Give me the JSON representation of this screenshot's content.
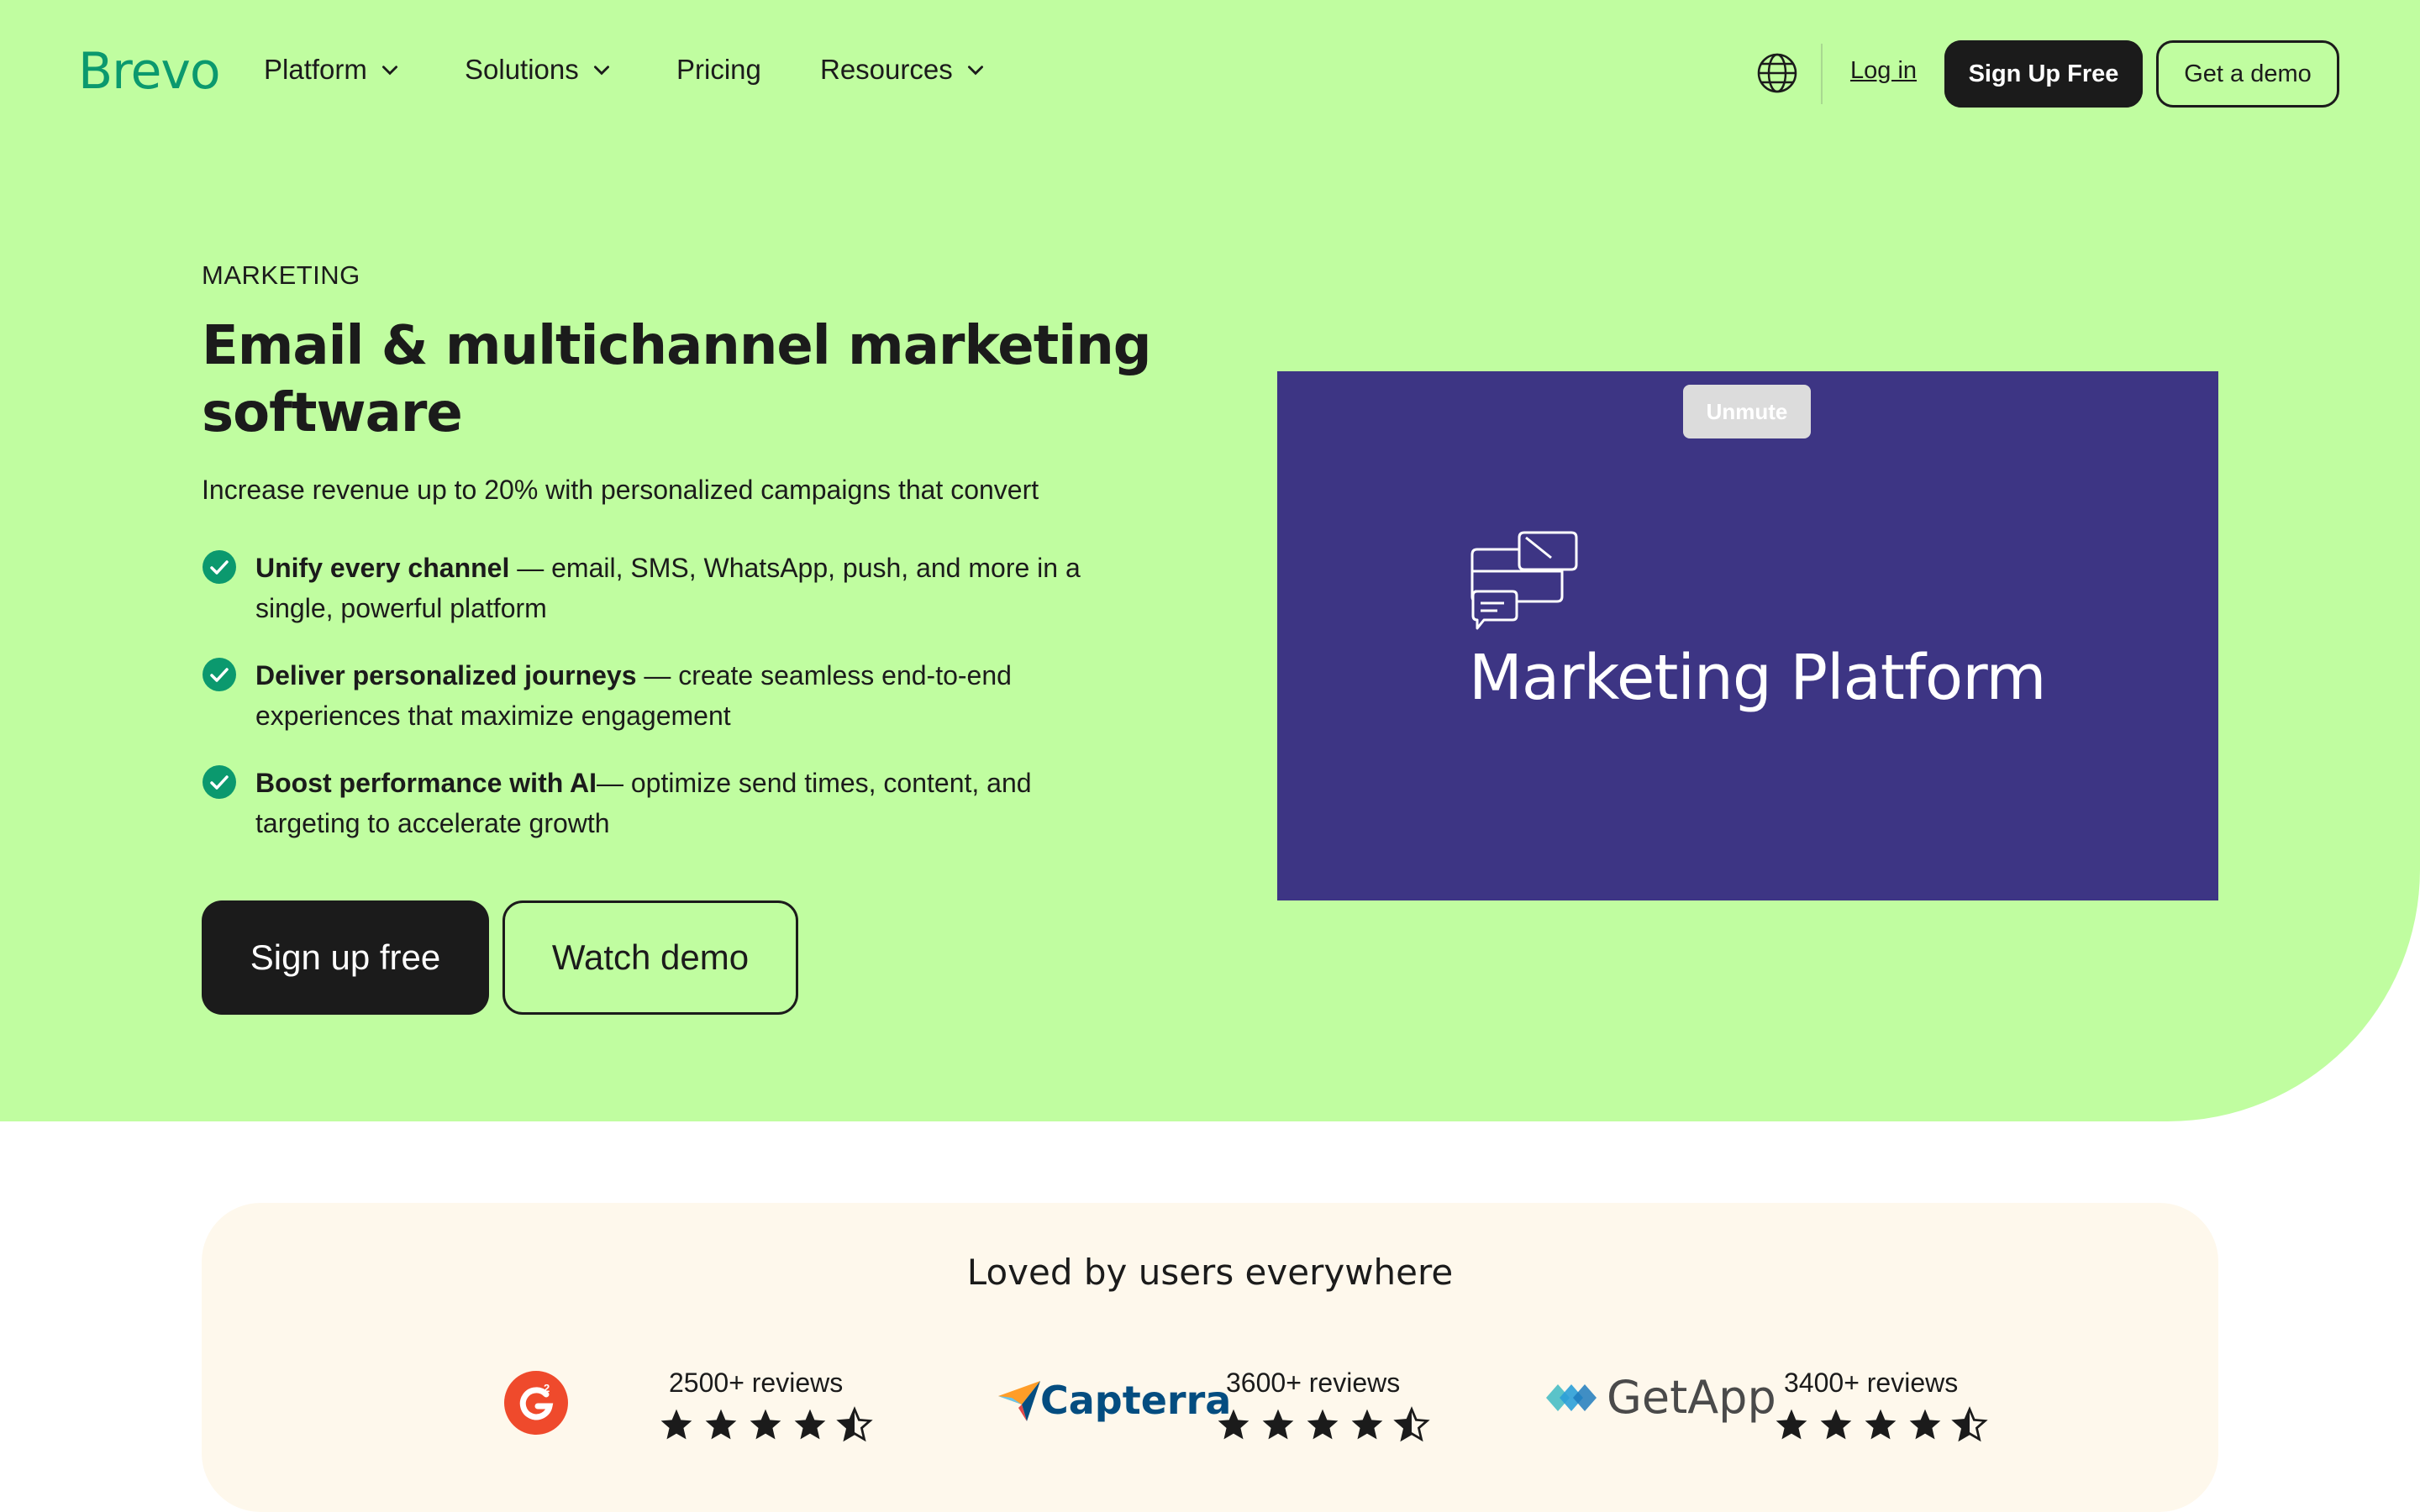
{
  "header": {
    "logo": "Brevo",
    "nav": [
      {
        "label": "Platform",
        "has_dropdown": true
      },
      {
        "label": "Solutions",
        "has_dropdown": true
      },
      {
        "label": "Pricing",
        "has_dropdown": false
      },
      {
        "label": "Resources",
        "has_dropdown": true
      }
    ],
    "language_icon": "globe-icon",
    "login": "Log in",
    "signup": "Sign Up Free",
    "demo": "Get a demo"
  },
  "hero": {
    "eyebrow": "MARKETING",
    "title": "Email & multichannel marketing software",
    "subtitle": "Increase revenue up to 20% with personalized campaigns that convert",
    "bullets": [
      {
        "bold": "Unify every channel",
        "text": " — email, SMS, WhatsApp, push, and more in a single, powerful platform"
      },
      {
        "bold": "Deliver personalized journeys",
        "text": " — create seamless end-to-end experiences that maximize engagement"
      },
      {
        "bold": "Boost performance with AI",
        "text": "— optimize send times, content, and targeting to accelerate growth"
      }
    ],
    "cta_primary": "Sign up free",
    "cta_secondary": "Watch demo"
  },
  "video": {
    "unmute": "Unmute",
    "title": "Marketing Platform",
    "icon": "chat-bubbles-icon"
  },
  "reviews": {
    "title": "Loved by users everywhere",
    "items": [
      {
        "brand": "G2",
        "count": "2500+ reviews",
        "rating": 4.5
      },
      {
        "brand": "Capterra",
        "count": "3600+ reviews",
        "rating": 4.5
      },
      {
        "brand": "GetApp",
        "count": "3400+ reviews",
        "rating": 4.5
      }
    ]
  },
  "colors": {
    "hero_bg": "#c0fda0",
    "brand_green": "#0b996e",
    "video_bg": "#3d3584",
    "reviews_bg": "#fef8ec",
    "dark": "#1b1b1b"
  }
}
